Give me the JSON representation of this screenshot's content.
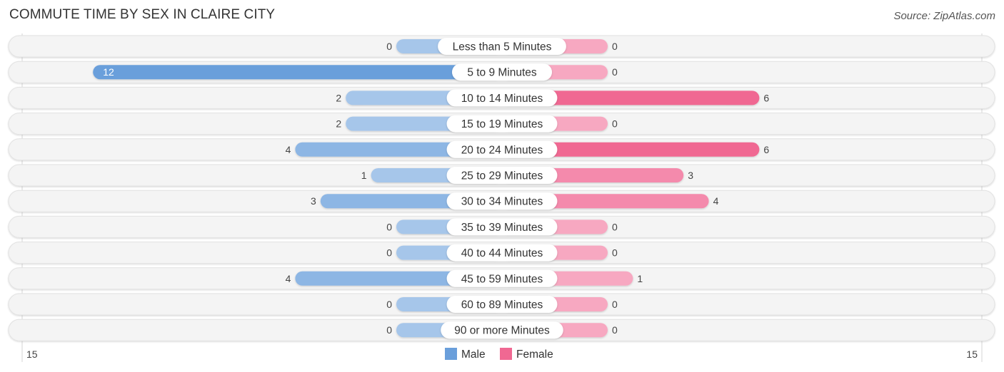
{
  "header": {
    "title": "COMMUTE TIME BY SEX IN CLAIRE CITY",
    "source": "Source: ZipAtlas.com"
  },
  "chart_data": {
    "type": "bar",
    "orientation": "horizontal-diverging",
    "title": "COMMUTE TIME BY SEX IN CLAIRE CITY",
    "categories": [
      "Less than 5 Minutes",
      "5 to 9 Minutes",
      "10 to 14 Minutes",
      "15 to 19 Minutes",
      "20 to 24 Minutes",
      "25 to 29 Minutes",
      "30 to 34 Minutes",
      "35 to 39 Minutes",
      "40 to 44 Minutes",
      "45 to 59 Minutes",
      "60 to 89 Minutes",
      "90 or more Minutes"
    ],
    "series": [
      {
        "name": "Male",
        "color": "#6a9fdb",
        "values": [
          0,
          12,
          2,
          2,
          4,
          1,
          3,
          0,
          0,
          4,
          0,
          0
        ]
      },
      {
        "name": "Female",
        "color": "#f06892",
        "values": [
          0,
          0,
          6,
          0,
          6,
          3,
          4,
          0,
          0,
          1,
          0,
          0
        ]
      }
    ],
    "axis": {
      "left_max_label": "15",
      "right_max_label": "15",
      "range": [
        0,
        15
      ]
    },
    "legend": {
      "position": "bottom-center",
      "items": [
        "Male",
        "Female"
      ]
    },
    "grid": false
  }
}
